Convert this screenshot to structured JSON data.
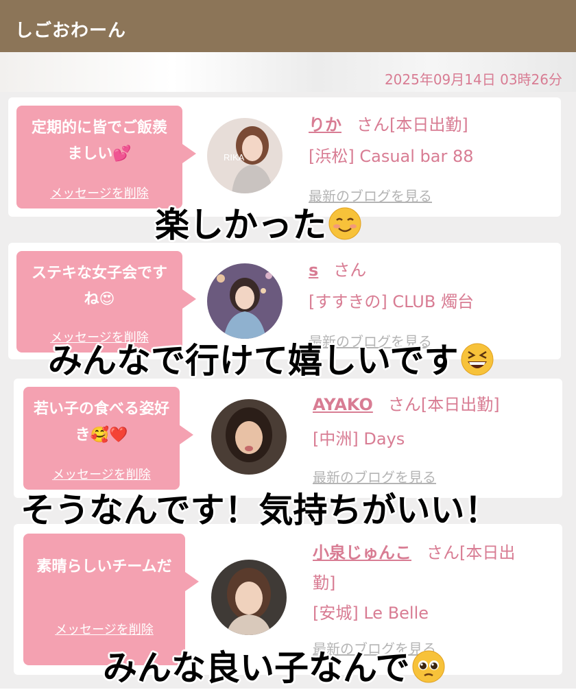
{
  "header": {
    "title": "しごおわーん"
  },
  "timestamp": "2025年09月14日 03時26分",
  "messages": [
    {
      "text": "定期的に皆でご飯羨ましい💕",
      "delete_label": "メッセージを削除",
      "avatar_text": "RIKA",
      "cast_name": "りか",
      "suffix": "さん[本日出勤]",
      "shop": "[浜松] Casual bar 88",
      "blog_label": "最新のブログを見る"
    },
    {
      "text": "ステキな女子会ですね😍",
      "delete_label": "メッセージを削除",
      "cast_name": "s",
      "suffix": "さん",
      "shop": "[すすきの] CLUB 燭台",
      "blog_label": "最新のブログを見る"
    },
    {
      "text": "若い子の食べる姿好き🥰❤️",
      "delete_label": "メッセージを削除",
      "cast_name": "AYAKO",
      "suffix": "さん[本日出勤]",
      "shop": "[中洲] Days",
      "blog_label": "最新のブログを見る"
    },
    {
      "text": "素晴らしいチームだ",
      "delete_label": "メッセージを削除",
      "cast_name": "小泉じゅんこ",
      "suffix_line1": "さん[本日出",
      "suffix_line2": "勤]",
      "shop": "[安城] Le Belle",
      "blog_label": "最新のブログを見る"
    }
  ],
  "overlays": {
    "line1": "楽しかった",
    "line1_emoji": "smiling-face-icon",
    "line2": "みんなで行けて嬉しいです",
    "line2_emoji": "grinning-squinting-face-icon",
    "line3": "そうなんです！気持ちがいい！",
    "line4": "みんな良い子なんで",
    "line4_emoji": "pleading-face-icon"
  },
  "colors": {
    "header_bg": "#8c7558",
    "bubble_bg": "#f4a1b1",
    "accent_pink": "#d87c93",
    "list_bg": "#efeeee"
  }
}
